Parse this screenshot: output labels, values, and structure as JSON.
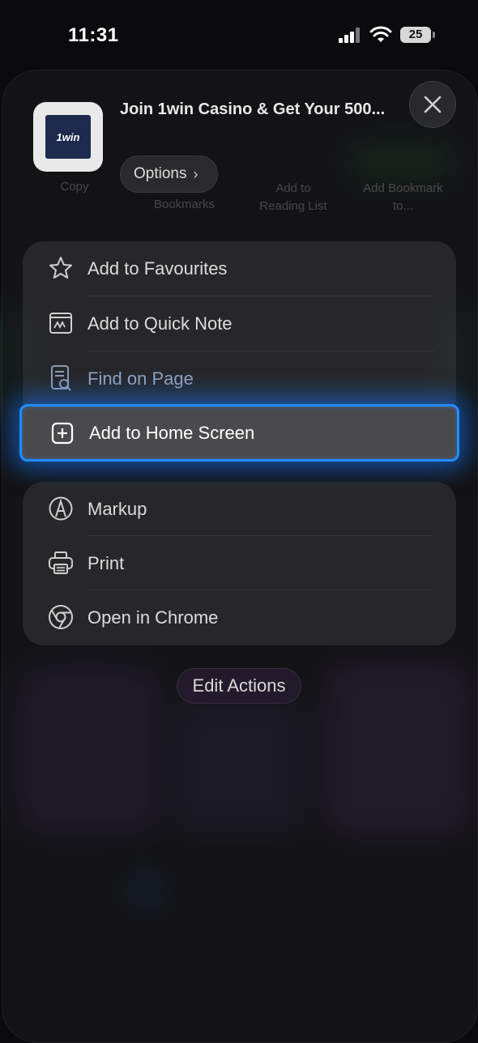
{
  "status_bar": {
    "time": "11:31",
    "battery": "25"
  },
  "share_header": {
    "title": "Join 1win Casino & Get Your 500...",
    "app_icon_text": "1win",
    "options_label": "Options"
  },
  "background_actions": [
    {
      "label": "Copy"
    },
    {
      "label": "Bookmarks"
    },
    {
      "label": "Add to Reading List"
    },
    {
      "label": "Add Bookmark to..."
    }
  ],
  "menu_group_1": [
    {
      "label": "Add to Favourites",
      "icon": "star-icon"
    },
    {
      "label": "Add to Quick Note",
      "icon": "quick-note-icon"
    },
    {
      "label": "Find on Page",
      "icon": "find-on-page-icon"
    }
  ],
  "highlighted_item": {
    "label": "Add to Home Screen",
    "icon": "add-square-icon",
    "accent": "#1f8cff"
  },
  "menu_group_2": [
    {
      "label": "Markup",
      "icon": "markup-icon"
    },
    {
      "label": "Print",
      "icon": "printer-icon"
    },
    {
      "label": "Open in Chrome",
      "icon": "chrome-icon"
    }
  ],
  "edit_actions_label": "Edit Actions"
}
